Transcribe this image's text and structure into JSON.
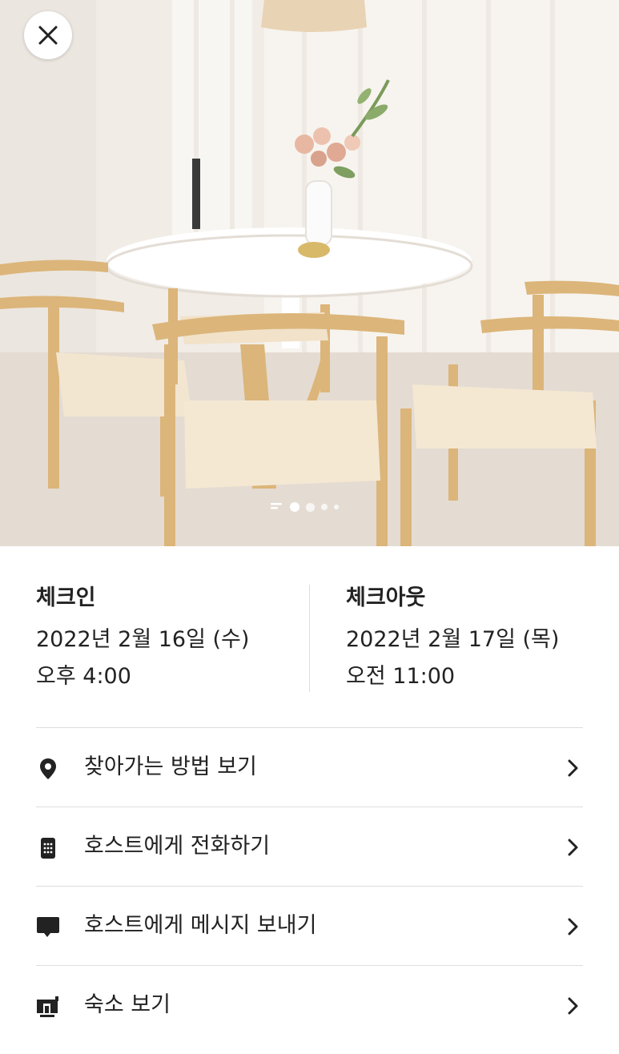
{
  "photo": {
    "description_icon": "dining-room-photo",
    "dots_count": 4,
    "active_dot_index": 0
  },
  "checkin": {
    "label": "체크인",
    "date": "2022년 2월 16일 (수)",
    "time": "오후 4:00"
  },
  "checkout": {
    "label": "체크아웃",
    "date": "2022년 2월 17일 (목)",
    "time": "오전 11:00"
  },
  "menu": {
    "items": [
      {
        "label": "찾아가는 방법 보기",
        "icon": "map-pin-icon"
      },
      {
        "label": "호스트에게 전화하기",
        "icon": "phone-icon"
      },
      {
        "label": "호스트에게 메시지 보내기",
        "icon": "message-icon"
      },
      {
        "label": "숙소 보기",
        "icon": "home-icon"
      }
    ]
  },
  "colors": {
    "text": "#222222",
    "divider": "#dddddd",
    "background": "#ffffff"
  }
}
